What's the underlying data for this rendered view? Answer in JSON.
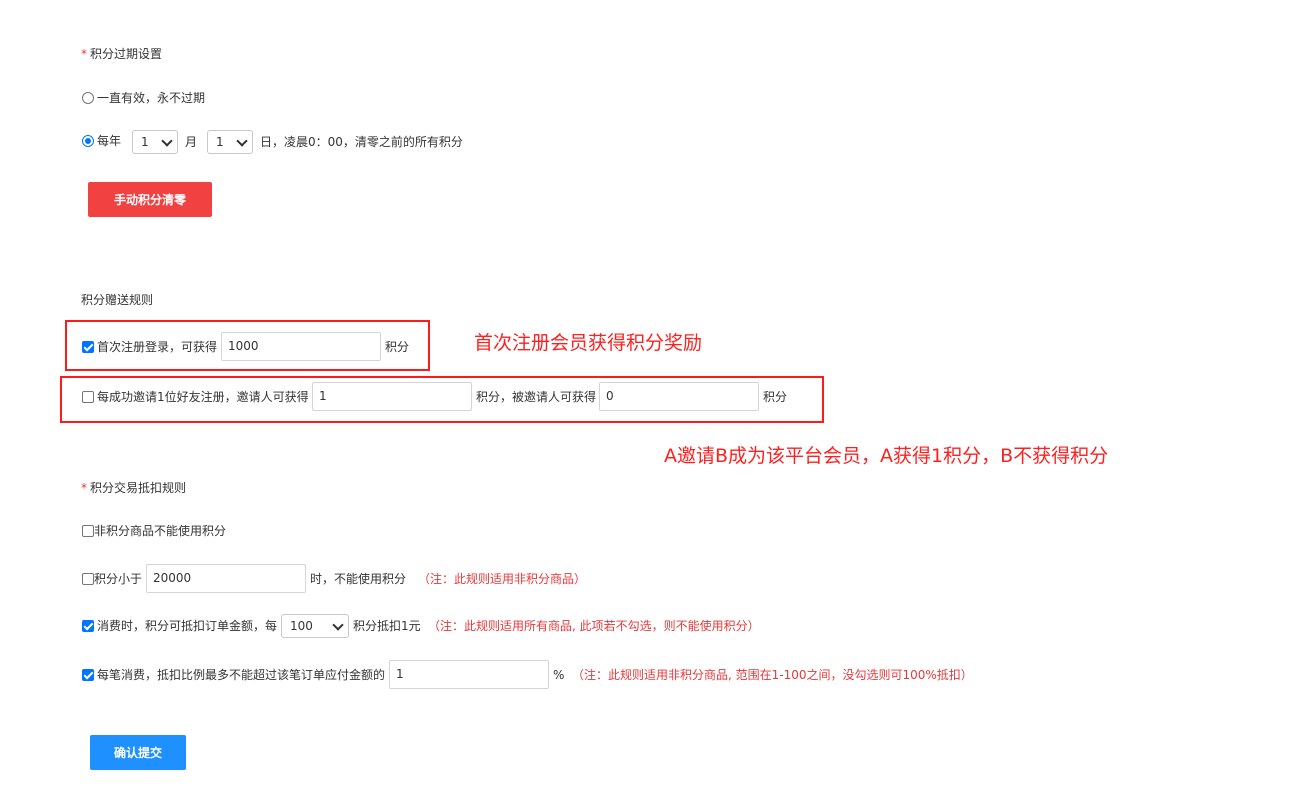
{
  "expiry": {
    "title": "积分过期设置",
    "option_never": "一直有效，永不过期",
    "option_yearly_prefix": "每年",
    "month_value": "1",
    "month_unit": "月",
    "day_value": "1",
    "yearly_suffix": "日，凌晨0：00，清零之前的所有积分",
    "clear_button": "手动积分清零"
  },
  "gift": {
    "title": "积分赠送规则",
    "register_label": "首次注册登录，可获得",
    "register_value": "1000",
    "register_unit": "积分",
    "invite_label": "每成功邀请1位好友注册，邀请人可获得",
    "inviter_value": "1",
    "invite_middle": "积分，被邀请人可获得",
    "invitee_value": "0",
    "invite_unit": "积分"
  },
  "deduct": {
    "title": "积分交易抵扣规则",
    "rule1": "非积分商品不能使用积分",
    "rule2_prefix": "积分小于",
    "rule2_value": "20000",
    "rule2_suffix": "时，不能使用积分",
    "rule2_note": "（注：此规则适用非积分商品）",
    "rule3_prefix": "消费时，积分可抵扣订单金额，每",
    "rule3_value": "100",
    "rule3_suffix": "积分抵扣1元",
    "rule3_note": "（注：此规则适用所有商品, 此项若不勾选，则不能使用积分）",
    "rule4_prefix": "每笔消费，抵扣比例最多不能超过该笔订单应付金额的",
    "rule4_value": "1",
    "rule4_unit": "%",
    "rule4_note": "（注：此规则适用非积分商品, 范围在1-100之间，没勾选则可100%抵扣）"
  },
  "submit_button": "确认提交",
  "annotations": {
    "register_note": "首次注册会员获得积分奖励",
    "invite_note": "A邀请B成为该平台会员，A获得1积分，B不获得积分"
  },
  "colors": {
    "accent_blue": "#1e90ff",
    "danger_red": "#f24141",
    "annotation_red": "#ff1a1a"
  }
}
